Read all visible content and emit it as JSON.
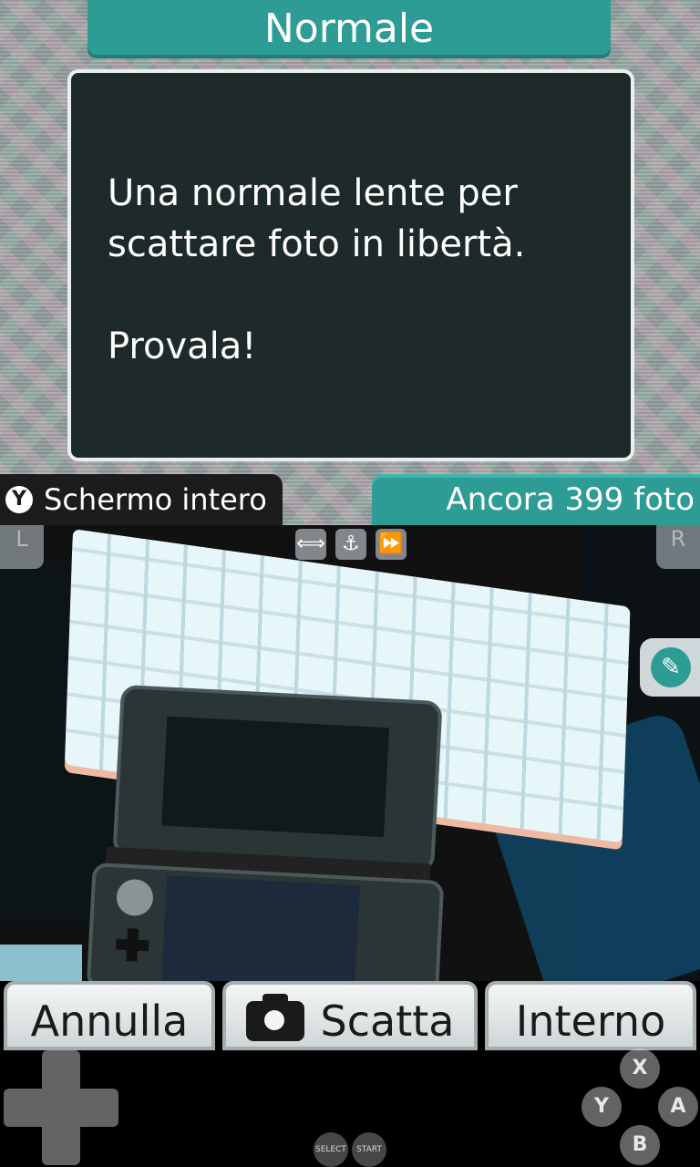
{
  "header": {
    "title": "Normale"
  },
  "description": {
    "text": "Una normale lente per\nscattare foto in libertà.\n\nProvala!"
  },
  "status": {
    "fullscreen_button_glyph": "Y",
    "fullscreen_label": "Schermo intero",
    "photos_left": "Ancora 399 foto"
  },
  "viewfinder": {
    "left_shoulder": "L",
    "right_shoulder": "R",
    "icons": [
      "flip-icon",
      "anchor-icon",
      "fast-forward-icon"
    ],
    "icon_glyphs": [
      "⟺",
      "⚓",
      "⏩"
    ],
    "eyedropper_glyph": "✎"
  },
  "buttons": {
    "cancel": "Annulla",
    "shoot": "Scatta",
    "internal": "Interno"
  },
  "emulator": {
    "x": "X",
    "y": "Y",
    "a": "A",
    "b": "B",
    "select": "SELECT",
    "start": "START"
  },
  "colors": {
    "accent": "#2d9c95",
    "dialog_bg": "#1e2a2a",
    "button_bg": "#e6ebeb"
  }
}
